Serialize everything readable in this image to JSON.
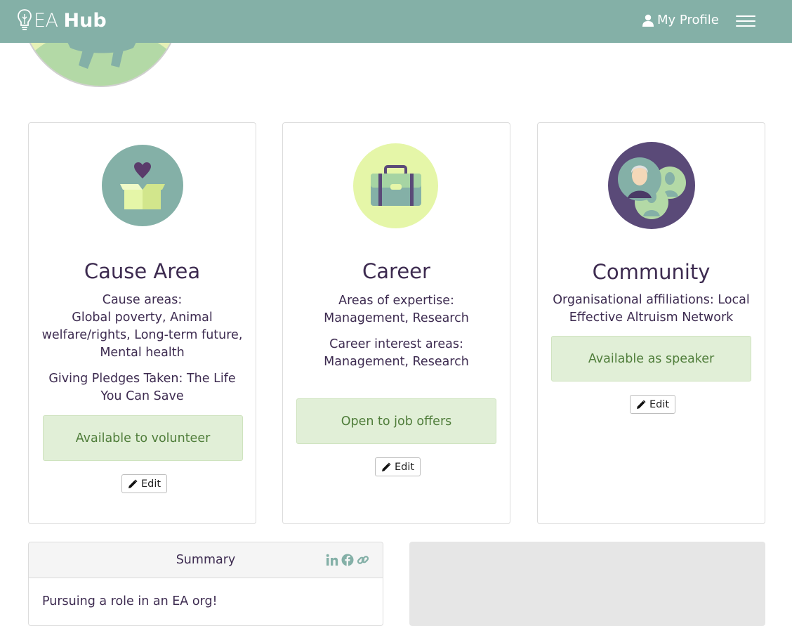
{
  "nav": {
    "brand_ea": "EA",
    "brand_hub": "Hub",
    "profile_label": "My Profile",
    "icons": [
      "lightbulb-icon",
      "user-icon",
      "hamburger-icon"
    ]
  },
  "cards": {
    "cause": {
      "title": "Cause Area",
      "areas_label": "Cause areas:",
      "areas_value": "Global poverty, Animal welfare/rights, Long-term future, Mental health",
      "pledges": "Giving Pledges Taken: The Life You Can Save",
      "badge": "Available to volunteer",
      "edit": "Edit"
    },
    "career": {
      "title": "Career",
      "expertise_label": "Areas of expertise:",
      "expertise_value": "Management, Research",
      "interest_label": "Career interest areas:",
      "interest_value": "Management, Research",
      "badge": "Open to job offers",
      "edit": "Edit"
    },
    "community": {
      "title": "Community",
      "affiliations": "Organisational affiliations: Local Effective Altruism Network",
      "badge": "Available as speaker",
      "edit": "Edit"
    }
  },
  "summary": {
    "title": "Summary",
    "body": "Pursuing a role in an EA org!",
    "social_icons": [
      "linkedin-icon",
      "facebook-icon",
      "link-icon"
    ]
  },
  "colors": {
    "navbar": "#84b0a7",
    "text": "#3d2b50",
    "badge_bg": "#e1efd7",
    "badge_text": "#4f7d3a",
    "teal": "#84b0a7",
    "lime": "#e5f6a8",
    "purple": "#5a4a78"
  }
}
